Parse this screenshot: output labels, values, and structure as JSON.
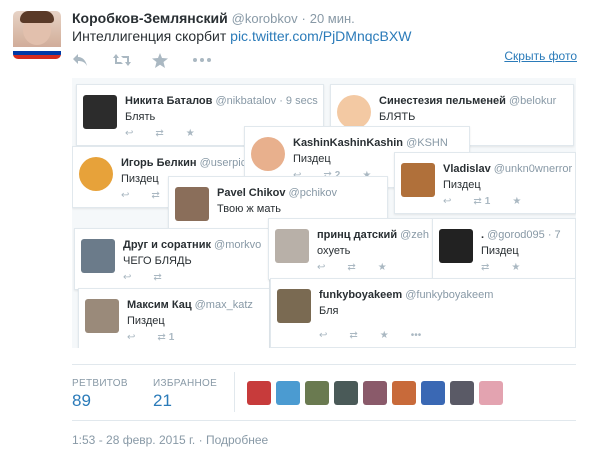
{
  "tweet": {
    "name": "Коробков-Землянский",
    "handle": "@korobkov",
    "dot": "·",
    "time": "20 мин.",
    "text": "Интеллигенция скорбит",
    "link": "pic.twitter.com/PjDMnqcBXW",
    "hide_photo": "Скрыть фото"
  },
  "collage": [
    {
      "name": "Никита Баталов",
      "handle": "@nikbatalov · 9 secs",
      "text": "Блять",
      "color": "#2c2c2c",
      "count": ""
    },
    {
      "name": "Синестезия пельменей",
      "handle": "@belokur",
      "text": "БЛЯТЬ",
      "color": "#f3c9a3",
      "count": ""
    },
    {
      "name": "Kashin⁣Kashin⁣Kashin",
      "handle": "@KSHN",
      "text": "Пиздец",
      "color": "#e8b08d",
      "count": "2"
    },
    {
      "name": "Игорь Белкин",
      "handle": "@userpic",
      "text": "Пиздец",
      "color": "#e7a23a",
      "count": ""
    },
    {
      "name": "Vladislav",
      "handle": "@unkn0wnerror",
      "text": "Пиздец",
      "color": "#b0703a",
      "count": "1"
    },
    {
      "name": "Pavel Chikov",
      "handle": "@pchikov",
      "text": "Твою ж мать",
      "color": "#8a6e5a",
      "count": ""
    },
    {
      "name": "Друг и соратник",
      "handle": "@morkvo",
      "text": "ЧЕГО БЛЯДЬ",
      "color": "#6b7b8a",
      "count": ""
    },
    {
      "name": "принц датский",
      "handle": "@zeh",
      "text": "охуеть",
      "color": "#b8b0a8",
      "count": ""
    },
    {
      "name": ".",
      "handle": "@gorod095 · 7",
      "text": "Пиздец",
      "color": "#222222",
      "count": ""
    },
    {
      "name": "Максим Кац",
      "handle": "@max_katz",
      "text": "Пиздец",
      "color": "#9a8a7a",
      "count": "1"
    },
    {
      "name": "funkyboyakeem",
      "handle": "@funkyboyakeem",
      "text": "Бля",
      "color": "#7a6a52",
      "count": ""
    }
  ],
  "stats": {
    "retweets_label": "РЕТВИТОВ",
    "retweets_value": "89",
    "favorites_label": "ИЗБРАННОЕ",
    "favorites_value": "21"
  },
  "favoriters": [
    "#c73b3b",
    "#4b9bd1",
    "#6a7a50",
    "#4a5a58",
    "#8a5a6a",
    "#c86a3a",
    "#3a68b4",
    "#5a5a66",
    "#e3a3b0"
  ],
  "footer": {
    "timestamp": "1:53 - 28 февр. 2015 г.",
    "dot": "·",
    "details": "Подробнее"
  }
}
